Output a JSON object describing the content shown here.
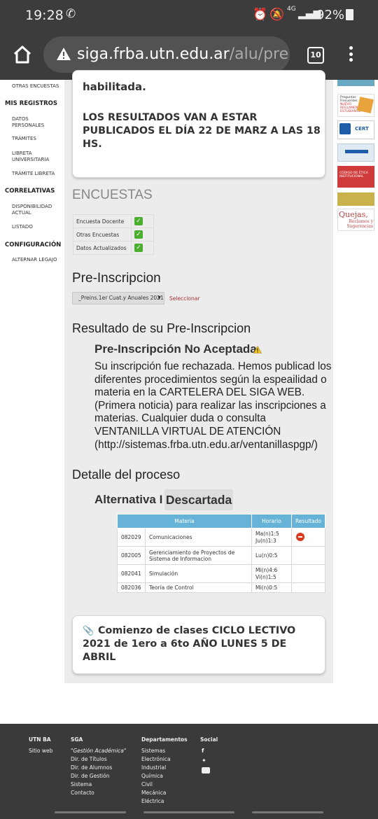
{
  "status_bar": {
    "time": "19:28",
    "net": "4G",
    "battery": "92%"
  },
  "address_bar": {
    "url_main": "siga.frba.utn.edu.ar",
    "url_path": "/alu/preir",
    "tab_count": "10"
  },
  "sidebar": {
    "items": [
      {
        "label": "OTRAS ENCUESTAS",
        "type": "item"
      },
      {
        "label": "MIS REGISTROS",
        "type": "header"
      },
      {
        "label": "DATOS PERSONALES",
        "type": "item"
      },
      {
        "label": "TRÁMITES",
        "type": "item"
      },
      {
        "label": "LIBRETA UNIVERSITARIA",
        "type": "item"
      },
      {
        "label": "TRÁMITE LIBRETA",
        "type": "item"
      },
      {
        "label": "CORRELATIVAS",
        "type": "header"
      },
      {
        "label": "DISPONIBILIDAD ACTUAL",
        "type": "item"
      },
      {
        "label": "LISTADO",
        "type": "item"
      },
      {
        "label": "CONFIGURACIÓN",
        "type": "header"
      },
      {
        "label": "ALTERNAR LEGAJO",
        "type": "item"
      }
    ]
  },
  "notice": {
    "line1": "habilitada.",
    "line2": "LOS RESULTADOS VAN A ESTAR PUBLICADOS EL DÍA 22 DE MARZ A LAS 18 HS."
  },
  "encuestas": {
    "title": "ENCUESTAS",
    "rows": [
      "Encuesta Docente",
      "Otras Encuestas",
      "Datos Actualizados"
    ]
  },
  "preinscripcion": {
    "title": "Pre-Inscripcion",
    "select_value": "_Preins.1er Cuat.y Anuales 2021",
    "select_button": "Seleccionar"
  },
  "resultado": {
    "title": "Resultado de su Pre-Inscripcion",
    "status": "Pre-Inscripción No Aceptada",
    "message": "Su inscripción fue rechazada. Hemos publicad los diferentes procedimientos según la espeailidad o materia en la CARTELERA DEL SIGA WEB. (Primera noticia) para realizar las inscripciones a materias. Cualquier duda o consulta VENTANILLA VIRTUAL DE ATENCIÓN (http://sistemas.frba.utn.edu.ar/ventanillaspgp/)"
  },
  "detalle": {
    "title": "Detalle del proceso",
    "alternativa": "Alternativa I",
    "estado": "Descartada",
    "columns": [
      "Materia",
      "Horario",
      "Resultado"
    ],
    "rows": [
      {
        "code": "082029",
        "name": "Comunicaciones",
        "horario": "Ma(n)1:5\nJu(n)1:3",
        "rejected": true
      },
      {
        "code": "082005",
        "name": "Gerenciamiento de Proyectos de Sistema de Informacion",
        "horario": "Lu(n)0:5",
        "rejected": false
      },
      {
        "code": "082041",
        "name": "Simulación",
        "horario": "Mi(n)4:6\nVi(n)1:5",
        "rejected": false
      },
      {
        "code": "082036",
        "name": "Teoría de Control",
        "horario": "Mi(n)0:5",
        "rejected": false
      }
    ]
  },
  "comienzo": {
    "text": "Comienzo de clases CICLO LECTIVO 2021 de 1ero a 6to AÑO LUNES 5 DE ABRIL"
  },
  "banners": {
    "preguntas": "Preguntas Frecuentes",
    "nuevo": "NUEVO REGLAMENTO ESTUDIANTIL",
    "cert": "CERT",
    "codigo": "CÓDIGO DE ÉTICA INSTITUCIONAL",
    "quejas": "Quejas,",
    "reclamos": "Reclamos y",
    "sugerencias": "Sugerencias"
  },
  "footer": {
    "col1_title": "UTN BA",
    "col1_items": [
      "Sitio web"
    ],
    "col2_title": "SGA",
    "col2_items": [
      "\"Gestión Académica\"",
      "Dir. de Títulos",
      "Dir. de Alumnos",
      "Dir. de Gestión",
      "Sistema",
      "Contacto"
    ],
    "col3_title": "Departamentos",
    "col3_items": [
      "Sistemas",
      "Electrónica",
      "Industrial",
      "Química",
      "Civil",
      "Mecánica",
      "Eléctrica"
    ],
    "col4_title": "Social"
  },
  "colors": {
    "accent_blue": "#67b3d8",
    "ok_green": "#4cae2f",
    "reject_red": "#d93a1f",
    "chrome_dark": "#3c3c3c"
  }
}
